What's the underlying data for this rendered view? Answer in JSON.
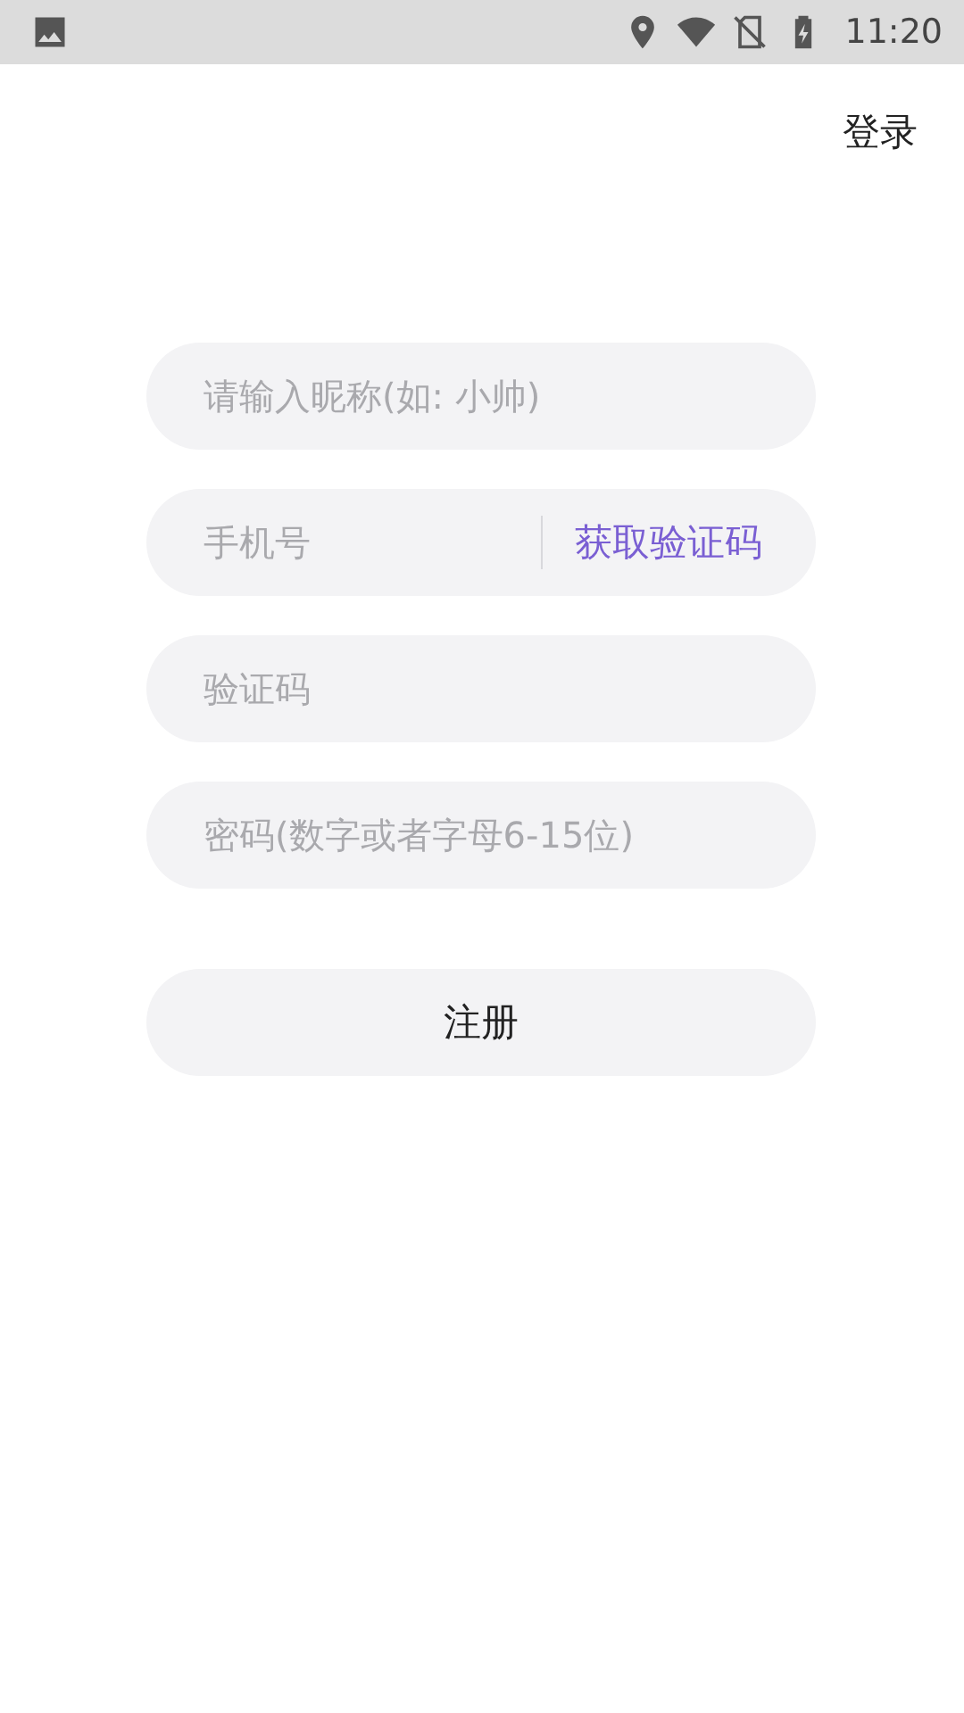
{
  "status_bar": {
    "time": "11:20"
  },
  "header": {
    "login_link": "登录"
  },
  "fields": [
    {
      "kind": "text",
      "placeholder": "请输入昵称(如: 小帅)"
    },
    {
      "kind": "phone",
      "placeholder": "手机号",
      "action": "获取验证码"
    },
    {
      "kind": "text",
      "placeholder": "验证码"
    },
    {
      "kind": "password",
      "placeholder": "密码(数字或者字母6-15位)"
    }
  ],
  "submit": "注册"
}
